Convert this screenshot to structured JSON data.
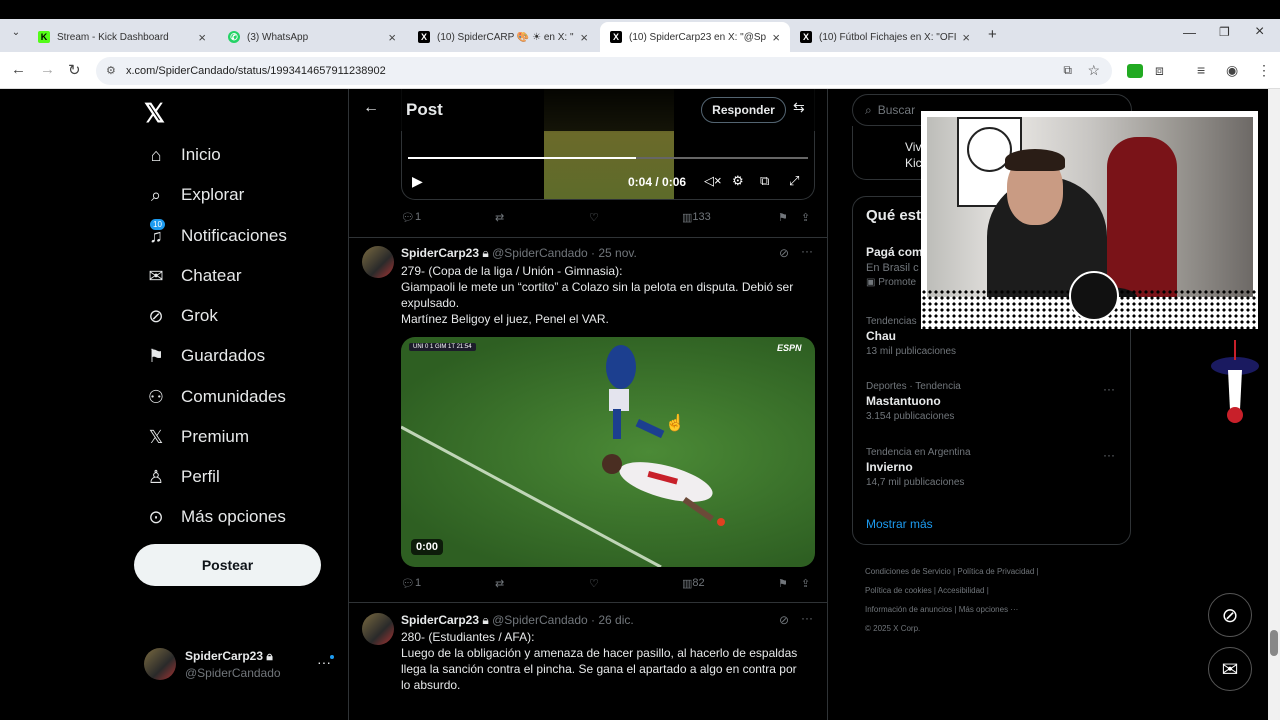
{
  "browser": {
    "tabs": [
      {
        "title": "Stream - Kick Dashboard",
        "icon": "K",
        "color": "#53fc18"
      },
      {
        "title": "(3) WhatsApp",
        "icon": "W",
        "color": "#25d366"
      },
      {
        "title": "(10) SpiderCARP 🎨 ☀ en X: \"L",
        "icon": "X",
        "color": "#000000"
      },
      {
        "title": "(10) SpiderCarp23 en X: \"@Spid",
        "icon": "X",
        "color": "#000000"
      },
      {
        "title": "(10) Fútbol Fichajes en X: \"OFIC",
        "icon": "X",
        "color": "#000000"
      }
    ],
    "url": "x.com/SpiderCandado/status/1993414657911238902"
  },
  "nav": {
    "items": [
      {
        "label": "Inicio",
        "icon": "home-icon"
      },
      {
        "label": "Explorar",
        "icon": "search-icon"
      },
      {
        "label": "Notificaciones",
        "icon": "bell-icon",
        "badge": "10"
      },
      {
        "label": "Chatear",
        "icon": "mail-icon"
      },
      {
        "label": "Grok",
        "icon": "grok-icon"
      },
      {
        "label": "Guardados",
        "icon": "bookmark-icon"
      },
      {
        "label": "Comunidades",
        "icon": "people-icon"
      },
      {
        "label": "Premium",
        "icon": "x-icon"
      },
      {
        "label": "Perfil",
        "icon": "person-icon"
      },
      {
        "label": "Más opciones",
        "icon": "more-circle-icon"
      }
    ],
    "post_label": "Postear",
    "profile": {
      "name": "SpiderCarp23",
      "handle": "@SpiderCandado"
    }
  },
  "header": {
    "title": "Post",
    "reply_label": "Responder"
  },
  "top_video": {
    "time": "0:04 / 0:06",
    "progress": 0.57
  },
  "top_actions": {
    "replies": "1",
    "views": "133"
  },
  "tweets": [
    {
      "name": "SpiderCarp23",
      "handle": "@SpiderCandado",
      "date": "· 25 nov.",
      "lines": [
        "279- (Copa de la liga / Unión - Gimnasia):",
        "Giampaoli le mete un “cortito” a Colazo sin la pelota en disputa. Debió ser",
        "expulsado.",
        "Martínez Beligoy el juez, Penel el VAR."
      ],
      "video_time": "0:00",
      "scoreboard": "UNI 0 1 GIM 1T 21:54",
      "broadcaster": "ESPN",
      "replies": "1",
      "views": "82"
    },
    {
      "name": "SpiderCarp23",
      "handle": "@SpiderCandado",
      "date": "· 26 dic.",
      "lines": [
        "280- (Estudiantes / AFA):",
        "Luego de la obligación y amenaza de hacer pasillo, al hacerlo de espaldas",
        "llega la sanción contra el pincha. Se gana el apartado a algo en contra por",
        "lo absurdo."
      ]
    }
  ],
  "right": {
    "search_placeholder": "Buscar",
    "partial_live": [
      "Viv",
      "Kic"
    ],
    "trends_title": "Qué est",
    "promo": {
      "name": "Pagá com",
      "sub": "En Brasil c",
      "tag": "Promote"
    },
    "trends": [
      {
        "category": "Tendencias",
        "name": "Chau",
        "count": "13 mil publicaciones"
      },
      {
        "category": "Deportes · Tendencia",
        "name": "Mastantuono",
        "count": "3.154 publicaciones"
      },
      {
        "category": "Tendencia en Argentina",
        "name": "Invierno",
        "count": "14,7 mil publicaciones"
      }
    ],
    "show_more": "Mostrar más",
    "footer": {
      "line1": [
        "Condiciones de Servicio",
        "Política de Privacidad"
      ],
      "line2": [
        "Política de cookies",
        "Accesibilidad"
      ],
      "line3": [
        "Información de anuncios",
        "Más opciones ···"
      ],
      "copyright": "© 2025 X Corp."
    }
  },
  "colors": {
    "accent": "#1d9bf0",
    "background": "#000000",
    "border": "#2f3336",
    "muted": "#71767b",
    "pitch": "#3f7a2e"
  }
}
